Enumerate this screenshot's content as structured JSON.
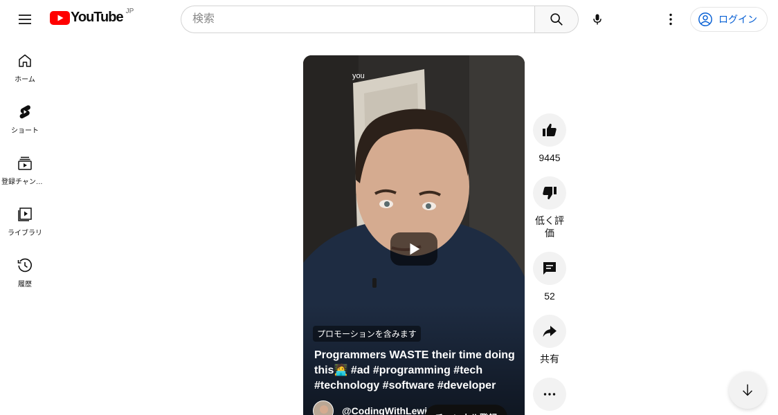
{
  "header": {
    "logo_text": "YouTube",
    "region": "JP",
    "search_placeholder": "検索",
    "login_label": "ログイン"
  },
  "sidebar": {
    "items": [
      {
        "label": "ホーム",
        "icon": "home-icon"
      },
      {
        "label": "ショート",
        "icon": "shorts-icon"
      },
      {
        "label": "登録チャンネル",
        "icon": "subscriptions-icon"
      },
      {
        "label": "ライブラリ",
        "icon": "library-icon"
      },
      {
        "label": "履歴",
        "icon": "history-icon"
      }
    ]
  },
  "video": {
    "top_caption": "you",
    "promo_label": "プロモーションを含みます",
    "title": "Programmers WASTE their time doing this🧑‍💻 #ad #programming #tech #technology #software #developer",
    "channel": "@CodingWithLewi",
    "subscribe_label": "チャンネル登録"
  },
  "actions": {
    "likes": "9445",
    "dislike_label": "低く評価",
    "comments": "52",
    "share_label": "共有"
  },
  "colors": {
    "brand_red": "#ff0000",
    "link_blue": "#065fd4"
  }
}
